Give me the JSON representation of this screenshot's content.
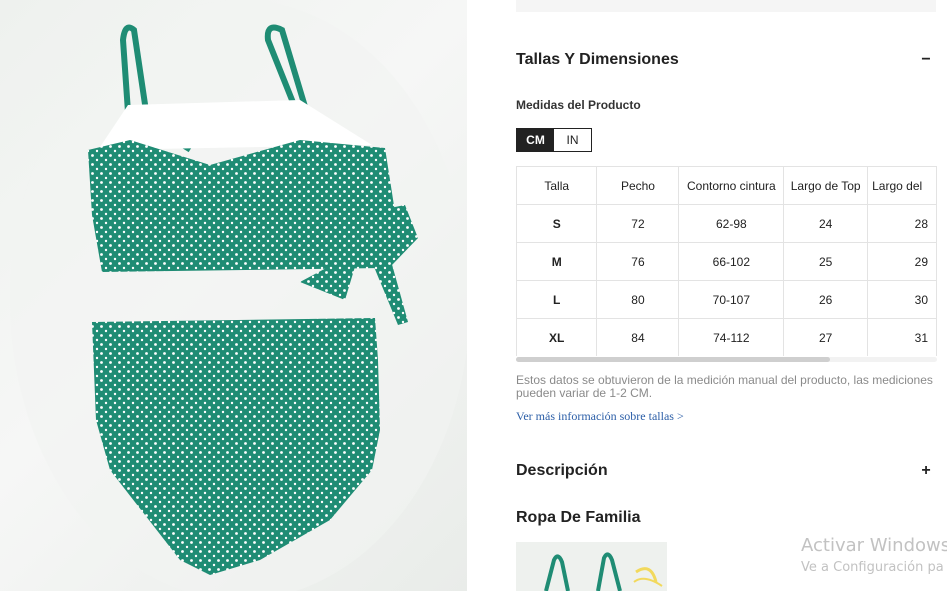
{
  "product": {
    "image_alt": "Bikini verde estampado floral"
  },
  "sizes_section": {
    "title": "Tallas Y Dimensiones",
    "toggle": "−",
    "subtitle": "Medidas del Producto",
    "units": [
      {
        "label": "CM",
        "active": true
      },
      {
        "label": "IN",
        "active": false
      }
    ],
    "table": {
      "headers": [
        "Talla",
        "Pecho",
        "Contorno cintura",
        "Largo de Top",
        "Largo del"
      ],
      "rows": [
        [
          "S",
          "72",
          "62-98",
          "24",
          "28"
        ],
        [
          "M",
          "76",
          "66-102",
          "25",
          "29"
        ],
        [
          "L",
          "80",
          "70-107",
          "26",
          "30"
        ],
        [
          "XL",
          "84",
          "74-112",
          "27",
          "31"
        ]
      ]
    },
    "note": "Estos datos se obtuvieron de la medición manual del producto, las mediciones pueden variar de 1-2 CM.",
    "more_link": "Ver más información sobre tallas >"
  },
  "description_section": {
    "title": "Descripción",
    "toggle": "+"
  },
  "family_section": {
    "title": "Ropa De Familia"
  },
  "windows_watermark": {
    "line1": "Activar Windows",
    "line2": "Ve a Configuración pa"
  },
  "colors": {
    "fabric": "#1f8c74",
    "dots": "#ffffff",
    "active_unit": "#222222",
    "link": "#2b5ea7"
  }
}
